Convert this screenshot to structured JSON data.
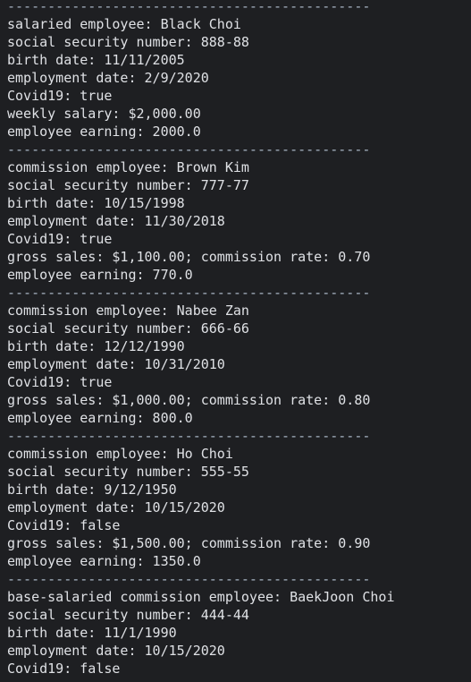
{
  "console": {
    "lines": [
      "---------------------------------------------",
      "salaried employee: Black Choi",
      "social security number: 888-88",
      "birth date: 11/11/2005",
      "employment date: 2/9/2020",
      "Covid19: true",
      "weekly salary: $2,000.00",
      "employee earning: 2000.0",
      "---------------------------------------------",
      "commission employee: Brown Kim",
      "social security number: 777-77",
      "birth date: 10/15/1998",
      "employment date: 11/30/2018",
      "Covid19: true",
      "gross sales: $1,100.00; commission rate: 0.70",
      "employee earning: 770.0",
      "---------------------------------------------",
      "commission employee: Nabee Zan",
      "social security number: 666-66",
      "birth date: 12/12/1990",
      "employment date: 10/31/2010",
      "Covid19: true",
      "gross sales: $1,000.00; commission rate: 0.80",
      "employee earning: 800.0",
      "---------------------------------------------",
      "commission employee: Ho Choi",
      "social security number: 555-55",
      "birth date: 9/12/1950",
      "employment date: 10/15/2020",
      "Covid19: false",
      "gross sales: $1,500.00; commission rate: 0.90",
      "employee earning: 1350.0",
      "---------------------------------------------",
      "base-salaried commission employee: BaekJoon Choi",
      "social security number: 444-44",
      "birth date: 11/1/1990",
      "employment date: 10/15/2020",
      "Covid19: false"
    ]
  }
}
